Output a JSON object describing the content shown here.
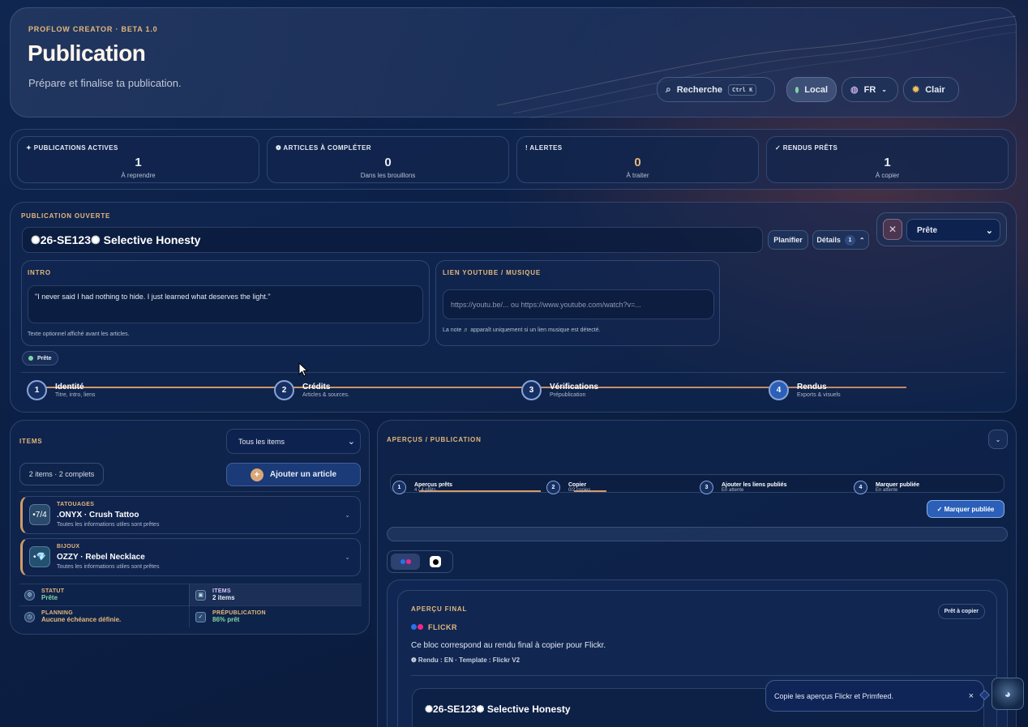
{
  "header": {
    "kicker": "PROFLOW CREATOR · BETA 1.0",
    "title": "Publication",
    "subtitle": "Prépare et finalise ta publication.",
    "search_label": "Recherche",
    "search_shortcut": "Ctrl K",
    "local_label": "Local",
    "lang_label": "FR",
    "theme_label": "Clair"
  },
  "stats": [
    {
      "label": "✦ PUBLICATIONS ACTIVES",
      "value": "1",
      "sub": "À reprendre"
    },
    {
      "label": "❁ ARTICLES À COMPLÉTER",
      "value": "0",
      "sub": "Dans les brouillons"
    },
    {
      "label": "! ALERTES",
      "value": "0",
      "sub": "À traiter"
    },
    {
      "label": "✓ RENDUS PRÊTS",
      "value": "1",
      "sub": "À copier"
    }
  ],
  "publication": {
    "section_label": "PUBLICATION OUVERTE",
    "title_value": "✺26-SE123✺ Selective Honesty",
    "plan_button": "Planifier",
    "details_button": "Détails",
    "details_count": "1",
    "status_select": "Prête",
    "intro_label": "INTRO",
    "intro_value": "\"I never said I had nothing to hide. I just learned what deserves the light.\"",
    "intro_hint": "Texte optionnel affiché avant les articles.",
    "link_label": "LIEN YOUTUBE / MUSIQUE",
    "link_placeholder": "https://youtu.be/... ou https://www.youtube.com/watch?v=...",
    "link_hint": "La note ♬ apparaît uniquement si un lien musique est détecté.",
    "status_badge": "Prête",
    "steps": [
      {
        "num": "1",
        "title": "Identité",
        "sub": "Titre, intro, liens"
      },
      {
        "num": "2",
        "title": "Crédits",
        "sub": "Articles & sources."
      },
      {
        "num": "3",
        "title": "Vérifications",
        "sub": "Prépublication"
      },
      {
        "num": "4",
        "title": "Rendus",
        "sub": "Exports & visuels"
      }
    ]
  },
  "items": {
    "section_label": "ITEMS",
    "filter_value": "Tous les items",
    "count_label": "2 items · 2 complets",
    "add_button": "Ajouter un article",
    "list": [
      {
        "category": "TATOUAGES",
        "name": ".ONYX · Crush Tattoo",
        "desc": "Toutes les informations utiles sont prêtes",
        "thumb": "•7/4"
      },
      {
        "category": "BIJOUX",
        "name": "OZZY · Rebel Necklace",
        "desc": "Toutes les informations utiles sont prêtes",
        "thumb": "•💎"
      }
    ],
    "summary": [
      {
        "label": "STATUT",
        "value": "Prête",
        "icon": "⚙"
      },
      {
        "label": "ITEMS",
        "value": "2 items",
        "icon": "▣"
      },
      {
        "label": "PLANNING",
        "value": "Aucune échéance définie.",
        "icon": "◷"
      },
      {
        "label": "PRÉPUBLICATION",
        "value": "86% prêt",
        "icon": "✓"
      }
    ]
  },
  "preview": {
    "section_label": "APERÇUS / PUBLICATION",
    "steps": [
      {
        "num": "1",
        "title": "Aperçus prêts",
        "sub": "4 / 4 prêts"
      },
      {
        "num": "2",
        "title": "Copier",
        "sub": "0/2 copies"
      },
      {
        "num": "3",
        "title": "Ajouter les liens publiés",
        "sub": "En attente"
      },
      {
        "num": "4",
        "title": "Marquer publiée",
        "sub": "En attente"
      }
    ],
    "mark_button": "✓ Marquer publiée",
    "final_label": "APERÇU FINAL",
    "ready_badge": "Prêt à copier",
    "platform": "FLICKR",
    "desc": "Ce bloc correspond au rendu final à copier pour Flickr.",
    "meta": "❁ Rendu : EN · Template : Flickr V2",
    "render_title": "✺26-SE123✺ Selective Honesty"
  },
  "toast": {
    "message": "Copie les aperçus Flickr et Primfeed.",
    "close": "×"
  },
  "colors": {
    "accent": "#e6b87c",
    "green": "#7fd6a4",
    "blue": "#2b5fb8"
  }
}
